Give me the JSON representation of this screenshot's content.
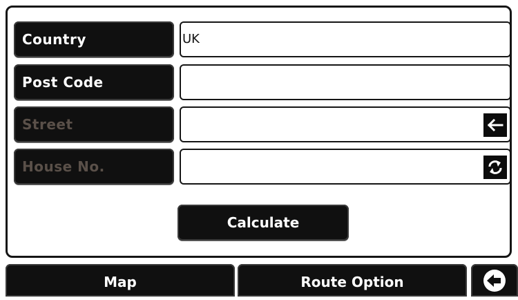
{
  "form": {
    "country": {
      "label": "Country",
      "value": "UK"
    },
    "post_code": {
      "label": "Post Code",
      "value": ""
    },
    "street": {
      "label": "Street",
      "value": ""
    },
    "house_no": {
      "label": "House No.",
      "value": ""
    }
  },
  "icons": {
    "street_field": "arrow-left-icon",
    "house_field": "swap-arrows-icon",
    "back_button": "back-arrow-icon"
  },
  "buttons": {
    "calculate": "Calculate",
    "map": "Map",
    "route_option": "Route Option"
  },
  "colors": {
    "button_bg": "#101010",
    "enabled_text": "#ffffff",
    "disabled_text": "#5a5049",
    "background": "#ffffff"
  }
}
